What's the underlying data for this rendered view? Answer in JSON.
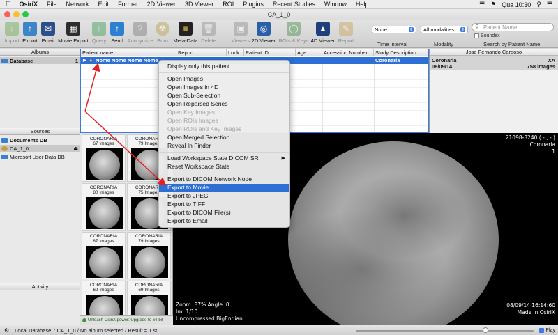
{
  "menubar": {
    "items": [
      "OsiriX",
      "File",
      "Network",
      "Edit",
      "Format",
      "2D Viewer",
      "3D Viewer",
      "ROI",
      "Plugins",
      "Recent Studies",
      "Window",
      "Help"
    ],
    "clock": "Qua 10:30"
  },
  "window": {
    "title": "CA_1_0"
  },
  "toolbar": {
    "buttons": [
      "Import",
      "Export",
      "Email",
      "Movie Export",
      "Query",
      "Send",
      "Anonymize",
      "Burn",
      "Meta-Data",
      "Delete",
      "Viewers",
      "2D Viewer",
      "ROIs & Keys",
      "4D Viewer",
      "Report"
    ],
    "time_interval_value": "None",
    "time_interval_label": "Time Interval",
    "modality_value": "All modalities",
    "modality_label": "Modality",
    "search_placeholder": "Patient Name",
    "soundex_label": "Soundex",
    "search_label": "Search by Patient Name"
  },
  "left": {
    "albums_header": "Albums",
    "database_label": "Database",
    "database_count": "1",
    "sources_header": "Sources",
    "sources": [
      "Documents DB",
      "CA_1_0",
      "Microsoft User Data DB"
    ],
    "activity_header": "Activity"
  },
  "table": {
    "columns": [
      "Patient name",
      "Report",
      "Lock",
      "Patient ID",
      "Age",
      "Accession Number",
      "Study Description"
    ],
    "row": {
      "name": "Nome Nome Nome Nome",
      "description": "Coronaria"
    }
  },
  "info": {
    "header": "Jose Fernando Cardoso",
    "study": "Coronaria",
    "modality": "XA",
    "date": "08/09/14",
    "images": "758 images"
  },
  "thumbs": [
    {
      "title": "CORONARIA",
      "count": "67 Images"
    },
    {
      "title": "CORONARIA",
      "count": "79 Images"
    },
    {
      "title": "CORONARIA",
      "count": "80 Images"
    },
    {
      "title": "CORONARIA",
      "count": "75 Images"
    },
    {
      "title": "CORONARIA",
      "count": "87 Images"
    },
    {
      "title": "CORONARIA",
      "count": "79 Images"
    },
    {
      "title": "CORONARIA",
      "count": "69 Images"
    },
    {
      "title": "CORONARIA",
      "count": "69 Images"
    }
  ],
  "upgrade": "Unleash OsiriX power: Upgrade to 64-bit",
  "viewer": {
    "top_right_1": "21098-3240 ( - , - )",
    "top_right_2": "Coronaria",
    "top_right_3": "1",
    "zoom": "Zoom: 87% Angle: 0",
    "image_index": "Im: 1/10",
    "encoding": "Uncompressed BigEndian",
    "datetime": "08/09/14 16:14:60",
    "made_in": "Made In OsiriX",
    "play_label": "Play"
  },
  "status": "Local Database: : CA_1_0 / No album selected / Result = 1 st...",
  "context_menu": {
    "items": [
      {
        "label": "Display only this patient",
        "state": "normal"
      },
      {
        "label": "Open Images",
        "state": "normal"
      },
      {
        "label": "Open Images in 4D",
        "state": "normal"
      },
      {
        "label": "Open Sub-Selection",
        "state": "normal"
      },
      {
        "label": "Open Reparsed Series",
        "state": "normal"
      },
      {
        "label": "Open Key Images",
        "state": "disabled"
      },
      {
        "label": "Open ROIs Images",
        "state": "disabled"
      },
      {
        "label": "Open ROIs and Key Images",
        "state": "disabled"
      },
      {
        "label": "Open Merged Selection",
        "state": "normal"
      },
      {
        "label": "Reveal In Finder",
        "state": "normal"
      },
      {
        "label": "Load Workspace State DICOM SR",
        "state": "normal"
      },
      {
        "label": "Reset Workspace State",
        "state": "normal"
      },
      {
        "label": "Export to DICOM Network Node",
        "state": "normal"
      },
      {
        "label": "Export to Movie",
        "state": "active"
      },
      {
        "label": "Export to JPEG",
        "state": "normal"
      },
      {
        "label": "Export to TIFF",
        "state": "normal"
      },
      {
        "label": "Export to DICOM File(s)",
        "state": "normal"
      },
      {
        "label": "Export to Email",
        "state": "normal"
      }
    ]
  },
  "colors": {
    "selection": "#2d6fd2",
    "annotation": "#e52020"
  }
}
